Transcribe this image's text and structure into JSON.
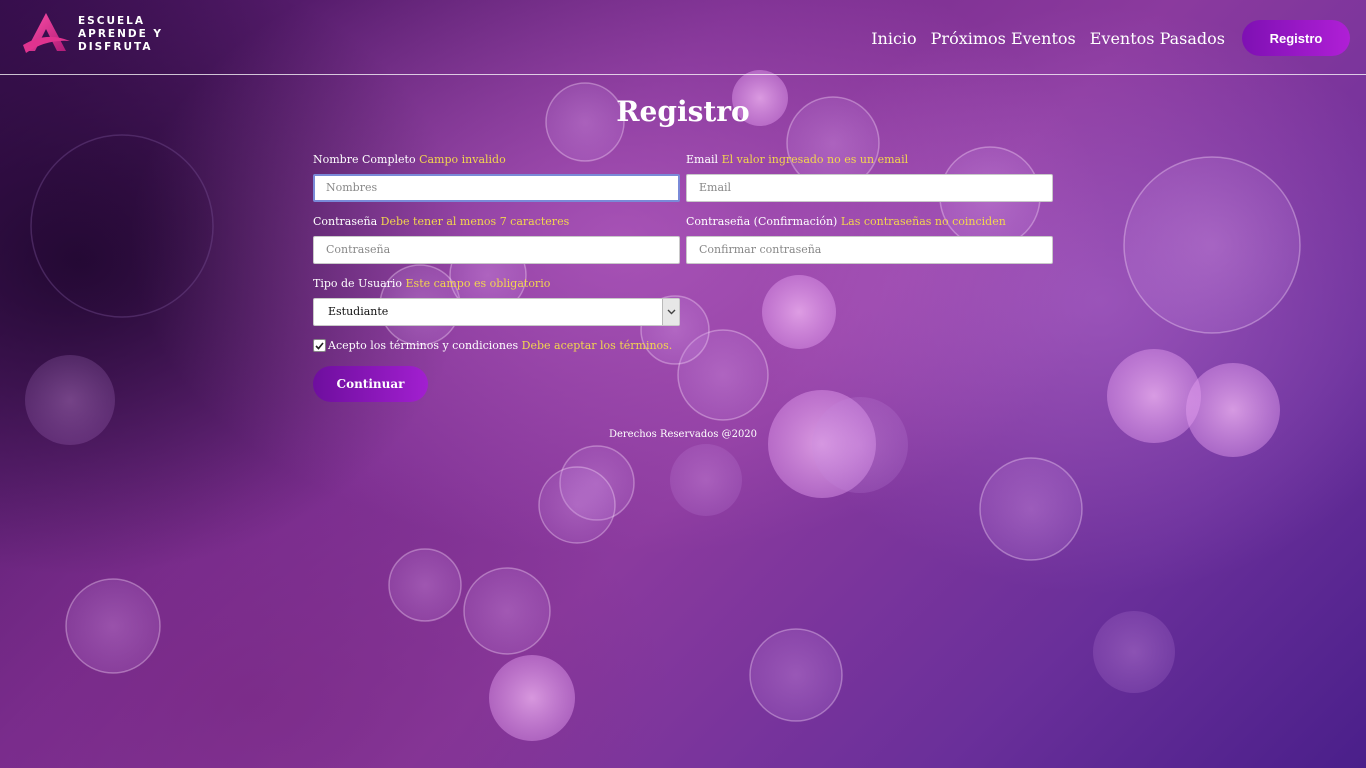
{
  "brand": {
    "line1": "ESCUELA",
    "line2": "APRENDE Y",
    "line3": "DISFRUTA",
    "logo_icon": "brand-a-logo",
    "accent_color": "#b01fd6"
  },
  "nav": {
    "items": [
      {
        "label": "Inicio"
      },
      {
        "label": "Próximos Eventos"
      },
      {
        "label": "Eventos Pasados"
      }
    ],
    "register_label": "Registro"
  },
  "form": {
    "title": "Registro",
    "fields": {
      "full_name": {
        "label": "Nombre Completo",
        "error": "Campo invalido",
        "placeholder": "Nombres"
      },
      "email": {
        "label": "Email",
        "error": "El valor ingresado no es un email",
        "placeholder": "Email"
      },
      "password": {
        "label": "Contraseña",
        "error": "Debe tener al menos 7 caracteres",
        "placeholder": "Contraseña"
      },
      "password_confirm": {
        "label": "Contraseña (Confirmación)",
        "error": "Las contraseñas no coinciden",
        "placeholder": "Confirmar contraseña"
      },
      "user_type": {
        "label": "Tipo de Usuario",
        "error": "Este campo es obligatorio",
        "selected": "Estudiante"
      }
    },
    "terms": {
      "label": "Acepto los términos y condiciones",
      "error": "Debe aceptar los términos.",
      "checked": true
    },
    "submit_label": "Continuar"
  },
  "footer": {
    "text": "Derechos Reservados @2020"
  },
  "colors": {
    "error_text": "#f3d64e",
    "button_gradient_start": "#6e0e9e",
    "button_gradient_end": "#a21fd0"
  }
}
